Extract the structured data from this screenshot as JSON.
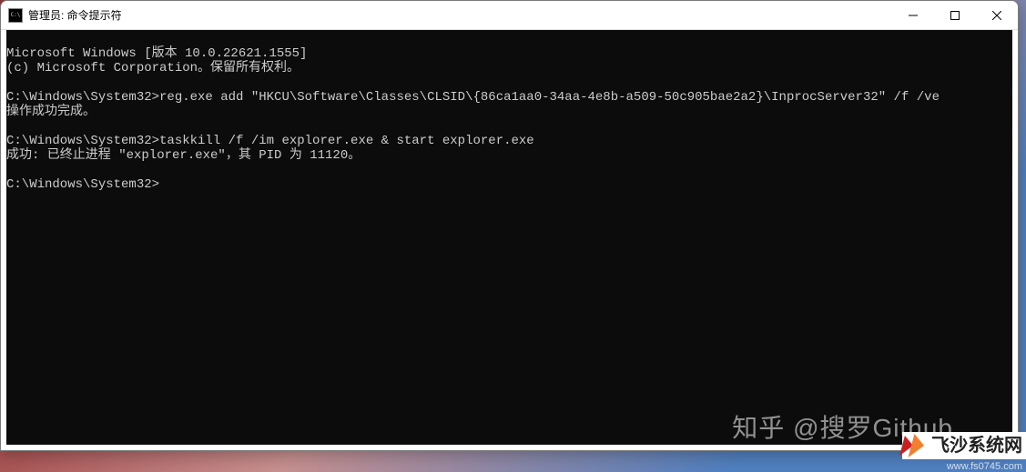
{
  "window": {
    "title": "管理员: 命令提示符"
  },
  "terminal": {
    "lines": [
      "Microsoft Windows [版本 10.0.22621.1555]",
      "(c) Microsoft Corporation。保留所有权利。",
      "",
      "C:\\Windows\\System32>reg.exe add \"HKCU\\Software\\Classes\\CLSID\\{86ca1aa0-34aa-4e8b-a509-50c905bae2a2}\\InprocServer32\" /f /ve",
      "操作成功完成。",
      "",
      "C:\\Windows\\System32>taskkill /f /im explorer.exe & start explorer.exe",
      "成功: 已终止进程 \"explorer.exe\"，其 PID 为 11120。",
      "",
      "C:\\Windows\\System32>"
    ]
  },
  "watermarks": {
    "zhihu": "知乎 @搜罗Github",
    "site_name": "飞沙系统网",
    "site_url": "www.fs0745.com"
  }
}
